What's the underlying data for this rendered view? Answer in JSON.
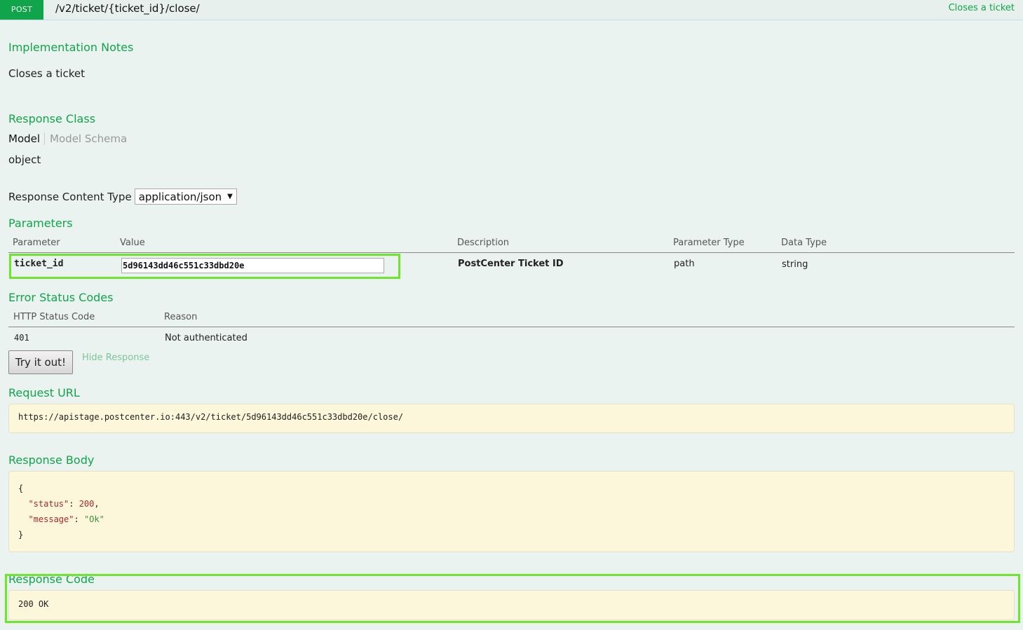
{
  "endpoint": {
    "method": "POST",
    "path": "/v2/ticket/{ticket_id}/close/",
    "summary": "Closes a ticket"
  },
  "implementation_notes": {
    "heading": "Implementation Notes",
    "text": "Closes a ticket"
  },
  "response_class": {
    "heading": "Response Class",
    "tab_model": "Model",
    "tab_schema": "Model Schema",
    "value": "object"
  },
  "content_type": {
    "label": "Response Content Type",
    "selected": "application/json"
  },
  "parameters": {
    "heading": "Parameters",
    "columns": [
      "Parameter",
      "Value",
      "Description",
      "Parameter Type",
      "Data Type"
    ],
    "rows": [
      {
        "name": "ticket_id",
        "value": "5d96143dd46c551c33dbd20e",
        "description": "PostCenter Ticket ID",
        "param_type": "path",
        "data_type": "string"
      }
    ]
  },
  "error_codes": {
    "heading": "Error Status Codes",
    "columns": [
      "HTTP Status Code",
      "Reason"
    ],
    "rows": [
      {
        "code": "401",
        "reason": "Not authenticated"
      }
    ]
  },
  "actions": {
    "try_label": "Try it out!",
    "hide_label": "Hide Response"
  },
  "request_url": {
    "heading": "Request URL",
    "value": "https://apistage.postcenter.io:443/v2/ticket/5d96143dd46c551c33dbd20e/close/"
  },
  "response_body": {
    "heading": "Response Body",
    "open_brace": "{",
    "close_brace": "}",
    "status_key": "\"status\"",
    "status_value": "200",
    "message_key": "\"message\"",
    "message_value": "\"Ok\""
  },
  "response_code": {
    "heading": "Response Code",
    "value": "200 OK"
  },
  "colors": {
    "accent": "#10a54a",
    "background": "#ebf3f0",
    "code_background": "#fcf6db",
    "highlight": "#6ee62e"
  }
}
